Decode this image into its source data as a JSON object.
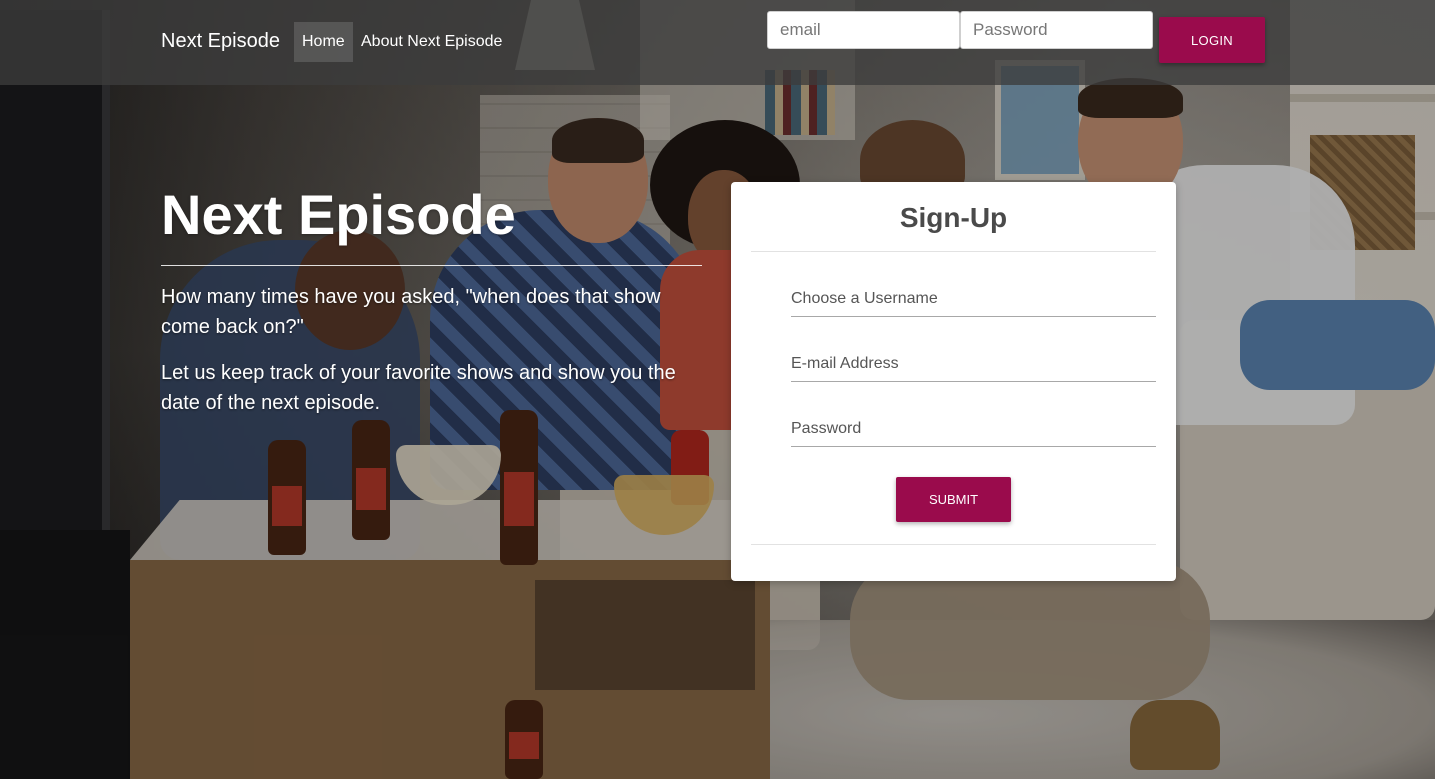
{
  "navbar": {
    "brand": "Next Episode",
    "links": [
      {
        "label": "Home",
        "active": true
      },
      {
        "label": "About Next Episode",
        "active": false
      }
    ],
    "login": {
      "email_placeholder": "email",
      "email_value": "",
      "password_placeholder": "Password",
      "password_value": "",
      "button_label": "LOGIN"
    }
  },
  "hero": {
    "title": "Next Episode",
    "paragraphs": [
      "How many times have you asked, \"when does that show come back on?\"",
      "Let us keep track of your favorite shows and show you the date of the next episode."
    ]
  },
  "signup": {
    "title": "Sign-Up",
    "username_placeholder": "Choose a Username",
    "email_placeholder": "E-mail Address",
    "password_placeholder": "Password",
    "submit_label": "SUBMIT"
  },
  "colors": {
    "accent": "#9a0b4c",
    "navbar_bg": "#3c3c3c"
  }
}
